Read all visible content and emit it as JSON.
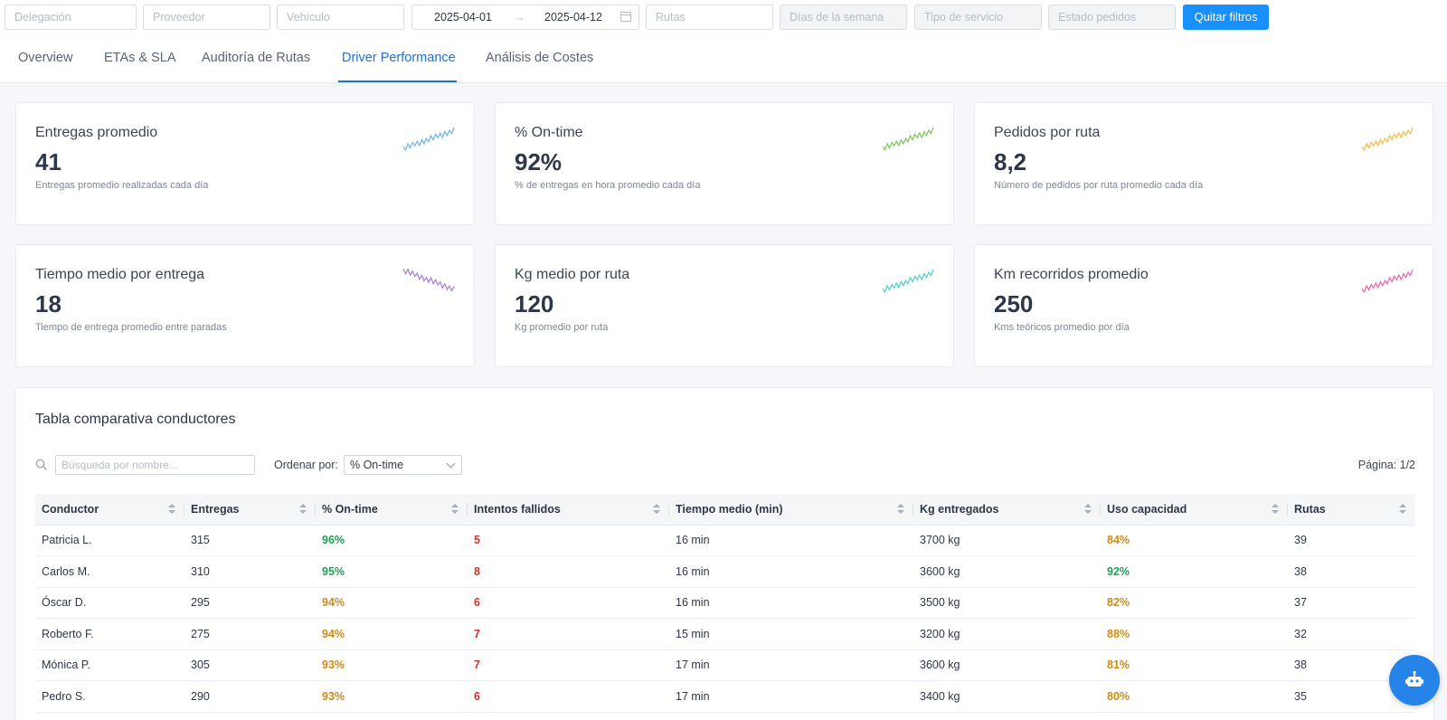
{
  "filters": {
    "delegacion": "Delegación",
    "proveedor": "Proveedor",
    "vehiculo": "Vehículo",
    "date_from": "2025-04-01",
    "date_arrow": "→",
    "date_to": "2025-04-12",
    "rutas": "Rutas",
    "dias": "Días de la semana",
    "tipo_servicio": "Tipo de servicio",
    "estado_pedidos": "Estado pedidos",
    "clear_label": "Quitar filtros"
  },
  "tabs": [
    {
      "label": "Overview"
    },
    {
      "label": "ETAs & SLA"
    },
    {
      "label": "Auditoría de Rutas"
    },
    {
      "label": "Driver Performance",
      "active": true
    },
    {
      "label": "Análisis de Costes"
    }
  ],
  "kpis": [
    {
      "title": "Entregas promedio",
      "value": "41",
      "subtitle": "Entregas promedio realizadas cada día",
      "color": "#5aaee8",
      "trend": "up"
    },
    {
      "title": "% On-time",
      "value": "92%",
      "subtitle": "% de entregas en hora promedio cada día",
      "color": "#6cc24a",
      "trend": "up"
    },
    {
      "title": "Pedidos por ruta",
      "value": "8,2",
      "subtitle": "Número de pedidos por ruta promedio cada día",
      "color": "#f2b531",
      "trend": "up"
    },
    {
      "title": "Tiempo medio por entrega",
      "value": "18",
      "subtitle": "Tiempo de entrega promedio entre paradas",
      "color": "#9b6fd6",
      "trend": "down"
    },
    {
      "title": "Kg medio por ruta",
      "value": "120",
      "subtitle": "Kg promedio por ruta",
      "color": "#3cc8c0",
      "trend": "up"
    },
    {
      "title": "Km recorridos promedio",
      "value": "250",
      "subtitle": "Kms teóricos promedio por día",
      "color": "#e0529c",
      "trend": "up"
    }
  ],
  "table_panel": {
    "title": "Tabla comparativa conductores",
    "search_placeholder": "Búsqueda por nombre...",
    "sort_label": "Ordenar por:",
    "sort_value": "% On-time",
    "page_info": "Página: 1/2",
    "columns": [
      "Conductor",
      "Entregas",
      "% On-time",
      "Intentos fallidos",
      "Tiempo medio (min)",
      "Kg entregados",
      "Uso capacidad",
      "Rutas"
    ],
    "rows": [
      {
        "conductor": "Patricia L.",
        "entregas": "315",
        "ontime": "96%",
        "ontime_status": "green",
        "fallidos": "5",
        "tiempo": "16 min",
        "kg": "3700 kg",
        "uso": "84%",
        "uso_status": "amber",
        "rutas": "39"
      },
      {
        "conductor": "Carlos M.",
        "entregas": "310",
        "ontime": "95%",
        "ontime_status": "green",
        "fallidos": "8",
        "tiempo": "16 min",
        "kg": "3600 kg",
        "uso": "92%",
        "uso_status": "green",
        "rutas": "38"
      },
      {
        "conductor": "Óscar D.",
        "entregas": "295",
        "ontime": "94%",
        "ontime_status": "amber",
        "fallidos": "6",
        "tiempo": "16 min",
        "kg": "3500 kg",
        "uso": "82%",
        "uso_status": "amber",
        "rutas": "37"
      },
      {
        "conductor": "Roberto F.",
        "entregas": "275",
        "ontime": "94%",
        "ontime_status": "amber",
        "fallidos": "7",
        "tiempo": "15 min",
        "kg": "3200 kg",
        "uso": "88%",
        "uso_status": "amber",
        "rutas": "32"
      },
      {
        "conductor": "Mónica P.",
        "entregas": "305",
        "ontime": "93%",
        "ontime_status": "amber",
        "fallidos": "7",
        "tiempo": "17 min",
        "kg": "3600 kg",
        "uso": "81%",
        "uso_status": "amber",
        "rutas": "38"
      },
      {
        "conductor": "Pedro S.",
        "entregas": "290",
        "ontime": "93%",
        "ontime_status": "amber",
        "fallidos": "6",
        "tiempo": "17 min",
        "kg": "3400 kg",
        "uso": "80%",
        "uso_status": "amber",
        "rutas": "35"
      },
      {
        "conductor": "",
        "entregas": "",
        "ontime": "",
        "ontime_status": "amber",
        "fallidos": "",
        "tiempo": "",
        "kg": "",
        "uso": "",
        "uso_status": "amber",
        "rutas": ""
      }
    ]
  },
  "chatbot": {
    "icon": "robot-icon"
  }
}
